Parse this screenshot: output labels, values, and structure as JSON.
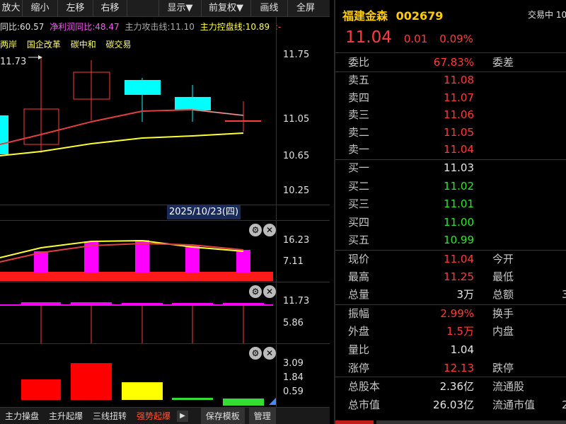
{
  "toolbar": {
    "buttons": [
      "放大",
      "缩小",
      "左移",
      "右移",
      "",
      "显示▼",
      "前复权▼",
      "画线",
      "全屏"
    ]
  },
  "info": {
    "segment1": "同比:60.57",
    "segment2": "净利润同比:48.47",
    "segment3": "主力攻击线:11.10",
    "segment4": "主力控盘线:10.89",
    "segment5": ":-"
  },
  "concepts": [
    "两岸",
    "国企改革",
    "碳中和",
    "碳交易"
  ],
  "main_chart": {
    "high_marker": "11.73",
    "price_axis": [
      "11.75",
      "11.05",
      "10.65",
      "10.25"
    ],
    "date_label": "2025/10/23(四)"
  },
  "panel1": {
    "axis": [
      "16.23",
      "7.11"
    ]
  },
  "panel2": {
    "axis": [
      "11.73",
      "5.86"
    ]
  },
  "panel3": {
    "axis": [
      "3.09",
      "1.84",
      "0.59"
    ]
  },
  "bottom_tabs": [
    "主力操盘",
    "主升起爆",
    "三线扭转",
    "强势起爆",
    "▶",
    "保存模板",
    "管理"
  ],
  "quote": {
    "name": "福建金森",
    "code": "002679",
    "status": "交易中 10",
    "price": "11.04",
    "change": "0.01",
    "change_pct": "0.09%",
    "weibi_label": "委比",
    "weibi_value": "67.83%",
    "weicha_label": "委差",
    "asks": [
      {
        "label": "卖五",
        "price": "11.08"
      },
      {
        "label": "卖四",
        "price": "11.07"
      },
      {
        "label": "卖三",
        "price": "11.06"
      },
      {
        "label": "卖二",
        "price": "11.05"
      },
      {
        "label": "卖一",
        "price": "11.04"
      }
    ],
    "bids": [
      {
        "label": "买一",
        "price": "11.03"
      },
      {
        "label": "买二",
        "price": "11.02"
      },
      {
        "label": "买三",
        "price": "11.01"
      },
      {
        "label": "买四",
        "price": "11.00"
      },
      {
        "label": "买五",
        "price": "10.99"
      }
    ],
    "stats": [
      {
        "l1": "现价",
        "v1": "11.04",
        "c1": "red",
        "l2": "今开",
        "v2": ""
      },
      {
        "l1": "最高",
        "v1": "11.25",
        "c1": "red",
        "l2": "最低",
        "v2": ""
      },
      {
        "l1": "总量",
        "v1": "3万",
        "c1": "white",
        "l2": "总额",
        "v2": "3"
      }
    ],
    "stats2": [
      {
        "l1": "振幅",
        "v1": "2.99%",
        "c1": "red",
        "l2": "换手",
        "v2": ""
      },
      {
        "l1": "外盘",
        "v1": "1.5万",
        "c1": "red",
        "l2": "内盘",
        "v2": ""
      },
      {
        "l1": "量比",
        "v1": "1.04",
        "c1": "white",
        "l2": "",
        "v2": ""
      },
      {
        "l1": "涨停",
        "v1": "12.13",
        "c1": "red",
        "l2": "跌停",
        "v2": ""
      },
      {
        "l1": "总股本",
        "v1": "2.36亿",
        "c1": "white",
        "l2": "流通股",
        "v2": ""
      },
      {
        "l1": "总市值",
        "v1": "26.03亿",
        "c1": "white",
        "l2": "流通市值",
        "v2": "2"
      }
    ]
  },
  "colors": {
    "up": "#ff3b3b",
    "down": "#2ee62e",
    "bear_candle": "#00ffff",
    "ma_yellow": "#ffff33",
    "magenta": "#ff00ff",
    "name_gold": "#ffcc00"
  }
}
